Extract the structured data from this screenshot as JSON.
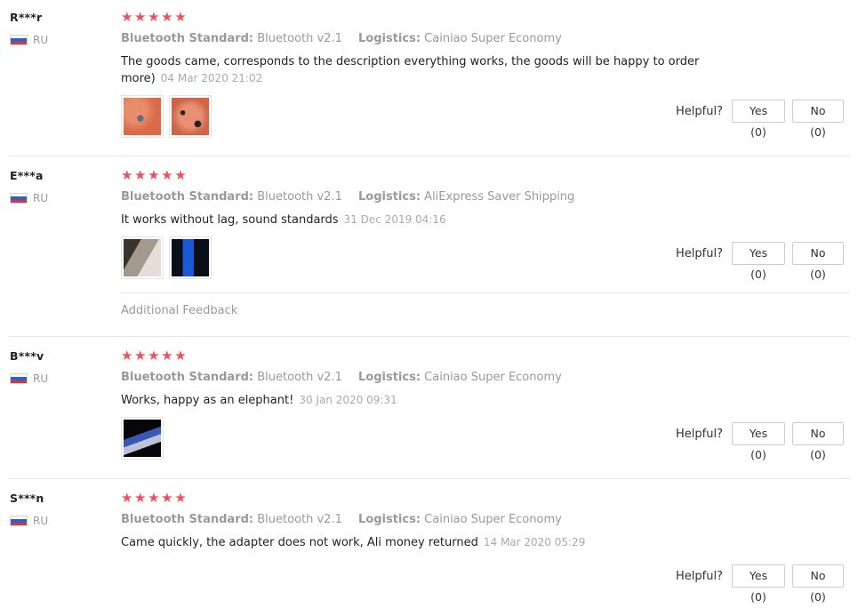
{
  "helpful_label": "Helpful?",
  "attr_label_1": "Bluetooth Standard:",
  "attr_label_2": "Logistics:",
  "additional_feedback": "Additional Feedback",
  "colors": {
    "stars": "#f0505a",
    "muted": "#999999",
    "text": "#222222"
  },
  "reviews": [
    {
      "user": "R***r",
      "country": "RU",
      "stars": "★★★★★",
      "bt": "Bluetooth v2.1",
      "logistics": "Cainiao Super Economy",
      "text": "The goods came, corresponds to the description everything works, the goods will be happy to order more)",
      "date": "04 Mar 2020 21:02",
      "yes": "Yes (0)",
      "no": "No (0)"
    },
    {
      "user": "E***a",
      "country": "RU",
      "stars": "★★★★★",
      "bt": "Bluetooth v2.1",
      "logistics": "AliExpress Saver Shipping",
      "text": "It works without lag, sound standards",
      "date": "31 Dec 2019 04:16",
      "yes": "Yes (0)",
      "no": "No (0)"
    },
    {
      "user": "B***v",
      "country": "RU",
      "stars": "★★★★★",
      "bt": "Bluetooth v2.1",
      "logistics": "Cainiao Super Economy",
      "text": "Works, happy as an elephant!",
      "date": "30 Jan 2020 09:31",
      "yes": "Yes (0)",
      "no": "No (0)"
    },
    {
      "user": "S***n",
      "country": "RU",
      "stars": "★★★★★",
      "bt": "Bluetooth v2.1",
      "logistics": "Cainiao Super Economy",
      "text": "Came quickly, the adapter does not work, Ali money returned",
      "date": "14 Mar 2020 05:29",
      "yes": "Yes (0)",
      "no": "No (0)"
    }
  ]
}
